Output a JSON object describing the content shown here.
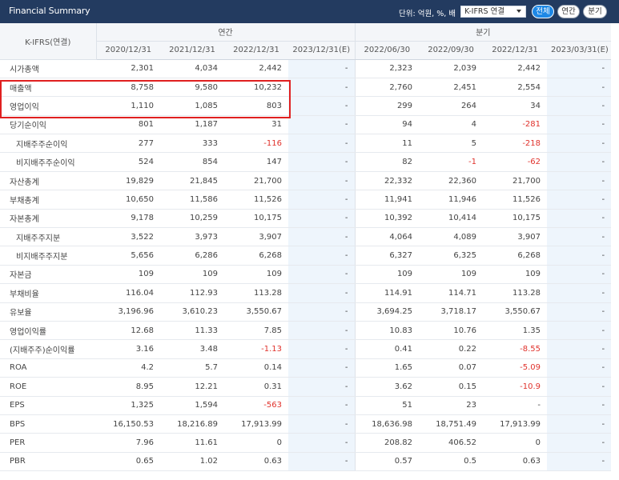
{
  "header": {
    "title": "Financial Summary",
    "unit_label": "단위: 억원, %, 배",
    "standard_select": "K-IFRS 연결",
    "btn_all": "전체",
    "btn_annual": "연간",
    "btn_quarter": "분기"
  },
  "table": {
    "corner_label": "K-IFRS(연결)",
    "group_annual": "연간",
    "group_quarter": "분기",
    "dates": [
      "2020/12/31",
      "2021/12/31",
      "2022/12/31",
      "2023/12/31(E)",
      "2022/06/30",
      "2022/09/30",
      "2022/12/31",
      "2023/03/31(E)"
    ],
    "rows": [
      {
        "label": "시가총액",
        "values": [
          "2,301",
          "4,034",
          "2,442",
          "-",
          "2,323",
          "2,039",
          "2,442",
          "-"
        ]
      },
      {
        "label": "매출액",
        "values": [
          "8,758",
          "9,580",
          "10,232",
          "-",
          "2,760",
          "2,451",
          "2,554",
          "-"
        ]
      },
      {
        "label": "영업이익",
        "values": [
          "1,110",
          "1,085",
          "803",
          "-",
          "299",
          "264",
          "34",
          "-"
        ]
      },
      {
        "label": "당기순이익",
        "values": [
          "801",
          "1,187",
          "31",
          "-",
          "94",
          "4",
          "-281",
          "-"
        ]
      },
      {
        "label": "지배주주순이익",
        "values": [
          "277",
          "333",
          "-116",
          "-",
          "11",
          "5",
          "-218",
          "-"
        ]
      },
      {
        "label": "비지배주주순이익",
        "values": [
          "524",
          "854",
          "147",
          "-",
          "82",
          "-1",
          "-62",
          "-"
        ]
      },
      {
        "label": "자산총계",
        "values": [
          "19,829",
          "21,845",
          "21,700",
          "-",
          "22,332",
          "22,360",
          "21,700",
          "-"
        ]
      },
      {
        "label": "부채총계",
        "values": [
          "10,650",
          "11,586",
          "11,526",
          "-",
          "11,941",
          "11,946",
          "11,526",
          "-"
        ]
      },
      {
        "label": "자본총계",
        "values": [
          "9,178",
          "10,259",
          "10,175",
          "-",
          "10,392",
          "10,414",
          "10,175",
          "-"
        ]
      },
      {
        "label": "지배주주지분",
        "values": [
          "3,522",
          "3,973",
          "3,907",
          "-",
          "4,064",
          "4,089",
          "3,907",
          "-"
        ]
      },
      {
        "label": "비지배주주지분",
        "values": [
          "5,656",
          "6,286",
          "6,268",
          "-",
          "6,327",
          "6,325",
          "6,268",
          "-"
        ]
      },
      {
        "label": "자본금",
        "values": [
          "109",
          "109",
          "109",
          "-",
          "109",
          "109",
          "109",
          "-"
        ]
      },
      {
        "label": "부채비율",
        "values": [
          "116.04",
          "112.93",
          "113.28",
          "-",
          "114.91",
          "114.71",
          "113.28",
          "-"
        ]
      },
      {
        "label": "유보율",
        "values": [
          "3,196.96",
          "3,610.23",
          "3,550.67",
          "-",
          "3,694.25",
          "3,718.17",
          "3,550.67",
          "-"
        ]
      },
      {
        "label": "영업이익률",
        "values": [
          "12.68",
          "11.33",
          "7.85",
          "-",
          "10.83",
          "10.76",
          "1.35",
          "-"
        ]
      },
      {
        "label": "(지배주주)순이익률",
        "values": [
          "3.16",
          "3.48",
          "-1.13",
          "-",
          "0.41",
          "0.22",
          "-8.55",
          "-"
        ]
      },
      {
        "label": "ROA",
        "values": [
          "4.2",
          "5.7",
          "0.14",
          "-",
          "1.65",
          "0.07",
          "-5.09",
          "-"
        ]
      },
      {
        "label": "ROE",
        "values": [
          "8.95",
          "12.21",
          "0.31",
          "-",
          "3.62",
          "0.15",
          "-10.9",
          "-"
        ]
      },
      {
        "label": "EPS",
        "values": [
          "1,325",
          "1,594",
          "-563",
          "-",
          "51",
          "23",
          "-",
          "-"
        ]
      },
      {
        "label": "BPS",
        "values": [
          "16,150.53",
          "18,216.89",
          "17,913.99",
          "-",
          "18,636.98",
          "18,751.49",
          "17,913.99",
          "-"
        ]
      },
      {
        "label": "PER",
        "values": [
          "7.96",
          "11.61",
          "0",
          "-",
          "208.82",
          "406.52",
          "0",
          "-"
        ]
      },
      {
        "label": "PBR",
        "values": [
          "0.65",
          "1.02",
          "0.63",
          "-",
          "0.57",
          "0.5",
          "0.63",
          "-"
        ]
      }
    ]
  },
  "colors": {
    "header_bg": "#233b60",
    "accent_blue": "#1e88e5",
    "negative_red": "#e0322c",
    "highlight_red": "#e02020",
    "estimate_bg": "#eef5fc"
  }
}
